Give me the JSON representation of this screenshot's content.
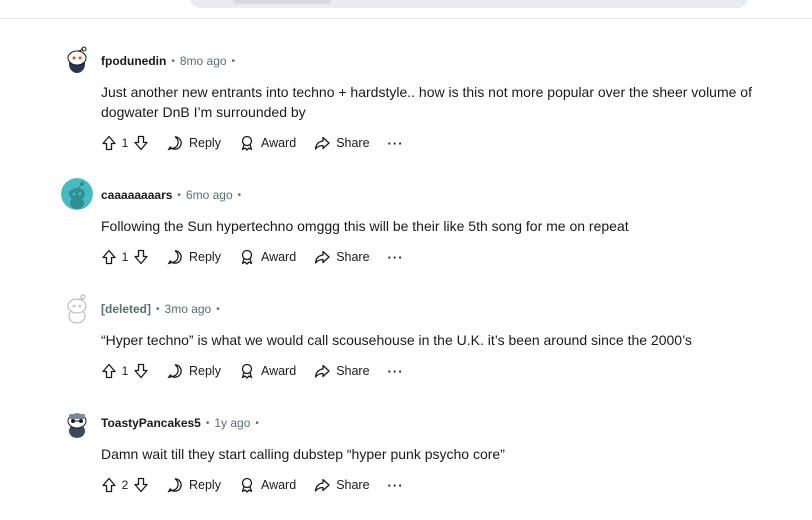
{
  "comments": [
    {
      "author": "fpodunedin",
      "time": "8mo ago",
      "body": "Just another new entrants into techno + hardstyle.. how is this not more popular over the sheer volume of dogwater DnB I’m surrounded by",
      "votes": "1",
      "reply_label": "Reply",
      "award_label": "Award",
      "share_label": "Share",
      "more_label": "···",
      "avatar_color": "#ffffff"
    },
    {
      "author": "caaaaaaaars",
      "time": "6mo ago",
      "body": "Following the Sun hypertechno omggg this will be their like 5th song for me on repeat",
      "votes": "1",
      "reply_label": "Reply",
      "award_label": "Award",
      "share_label": "Share",
      "more_label": "···",
      "avatar_color": "#46bac0"
    },
    {
      "author": "[deleted]",
      "time": "3mo ago",
      "body": "“Hyper techno” is what we would call scousehouse in the U.K. it’s been around since the 2000’s",
      "votes": "1",
      "reply_label": "Reply",
      "award_label": "Award",
      "share_label": "Share",
      "more_label": "···",
      "avatar_color": "#ffffff"
    },
    {
      "author": "ToastyPancakes5",
      "time": "1y ago",
      "body": "Damn wait till they start calling dubstep “hyper punk psycho core”",
      "votes": "2",
      "reply_label": "Reply",
      "award_label": "Award",
      "share_label": "Share",
      "more_label": "···",
      "avatar_color": "#ffffff"
    }
  ],
  "separator": "•"
}
